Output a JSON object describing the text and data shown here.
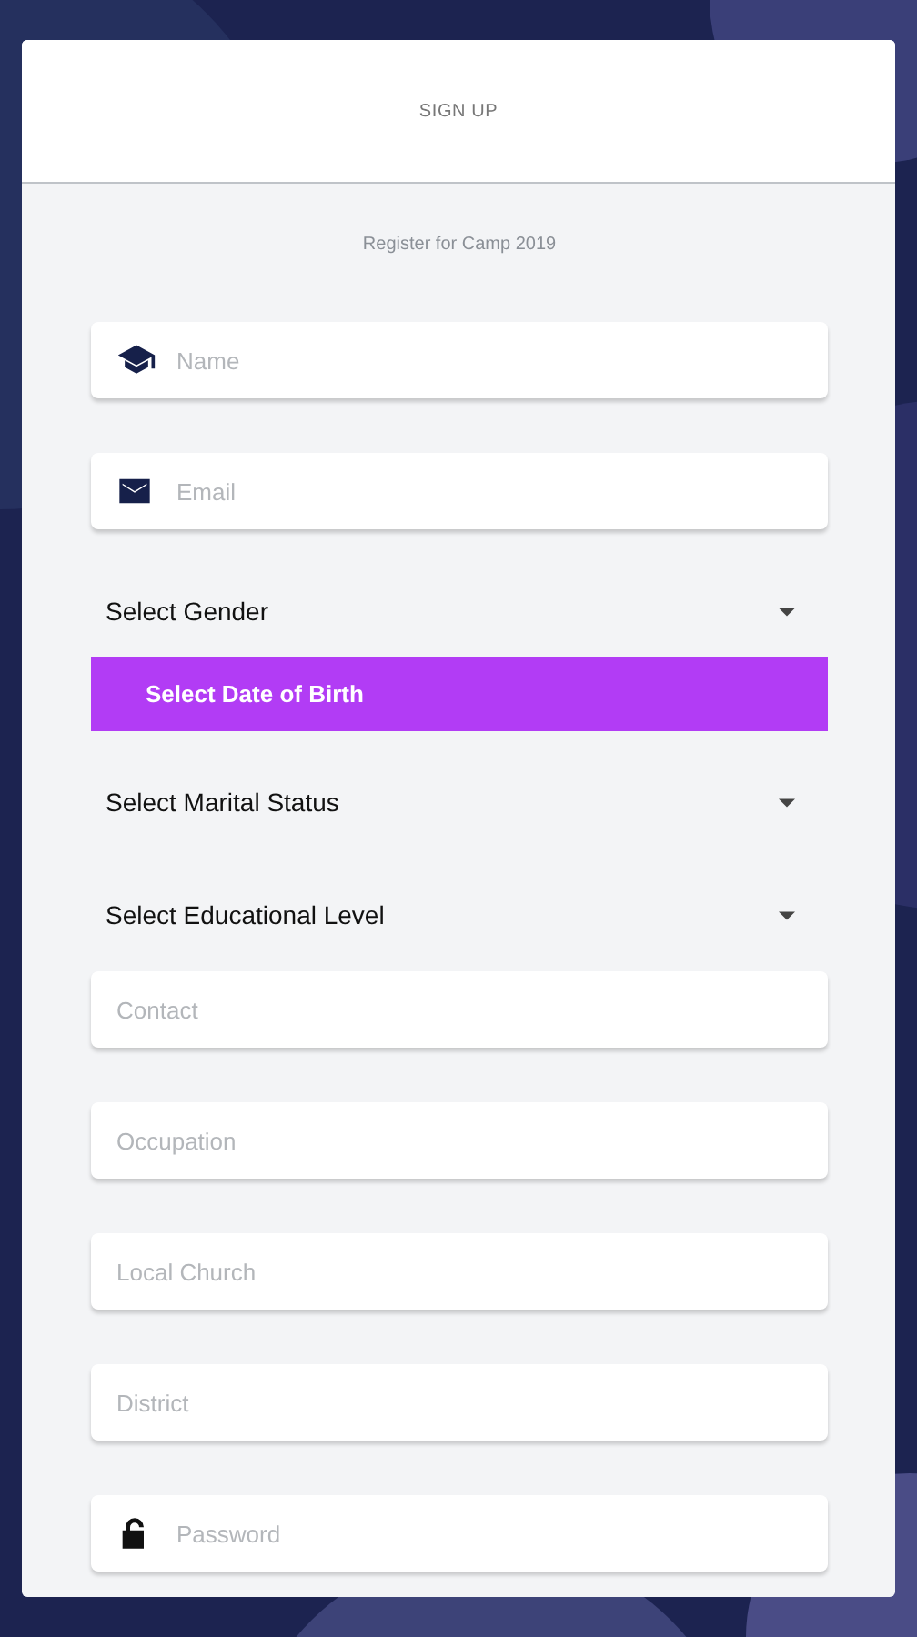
{
  "header": {
    "title": "SIGN UP"
  },
  "subtitle": "Register for Camp 2019",
  "fields": [
    {
      "kind": "input",
      "placeholder": "Name",
      "icon": true
    },
    {
      "kind": "input",
      "placeholder": "Email",
      "icon": true
    },
    {
      "kind": "select",
      "label": "Select Gender"
    },
    {
      "kind": "button",
      "label": "Select Date of Birth"
    },
    {
      "kind": "select",
      "label": "Select Marital Status"
    },
    {
      "kind": "select",
      "label": "Select Educational Level"
    },
    {
      "kind": "input",
      "placeholder": "Contact",
      "icon": false
    },
    {
      "kind": "input",
      "placeholder": "Occupation",
      "icon": false
    },
    {
      "kind": "input",
      "placeholder": "Local Church",
      "icon": false
    },
    {
      "kind": "input",
      "placeholder": "District",
      "icon": false
    },
    {
      "kind": "input",
      "placeholder": "Password",
      "icon": true
    }
  ]
}
